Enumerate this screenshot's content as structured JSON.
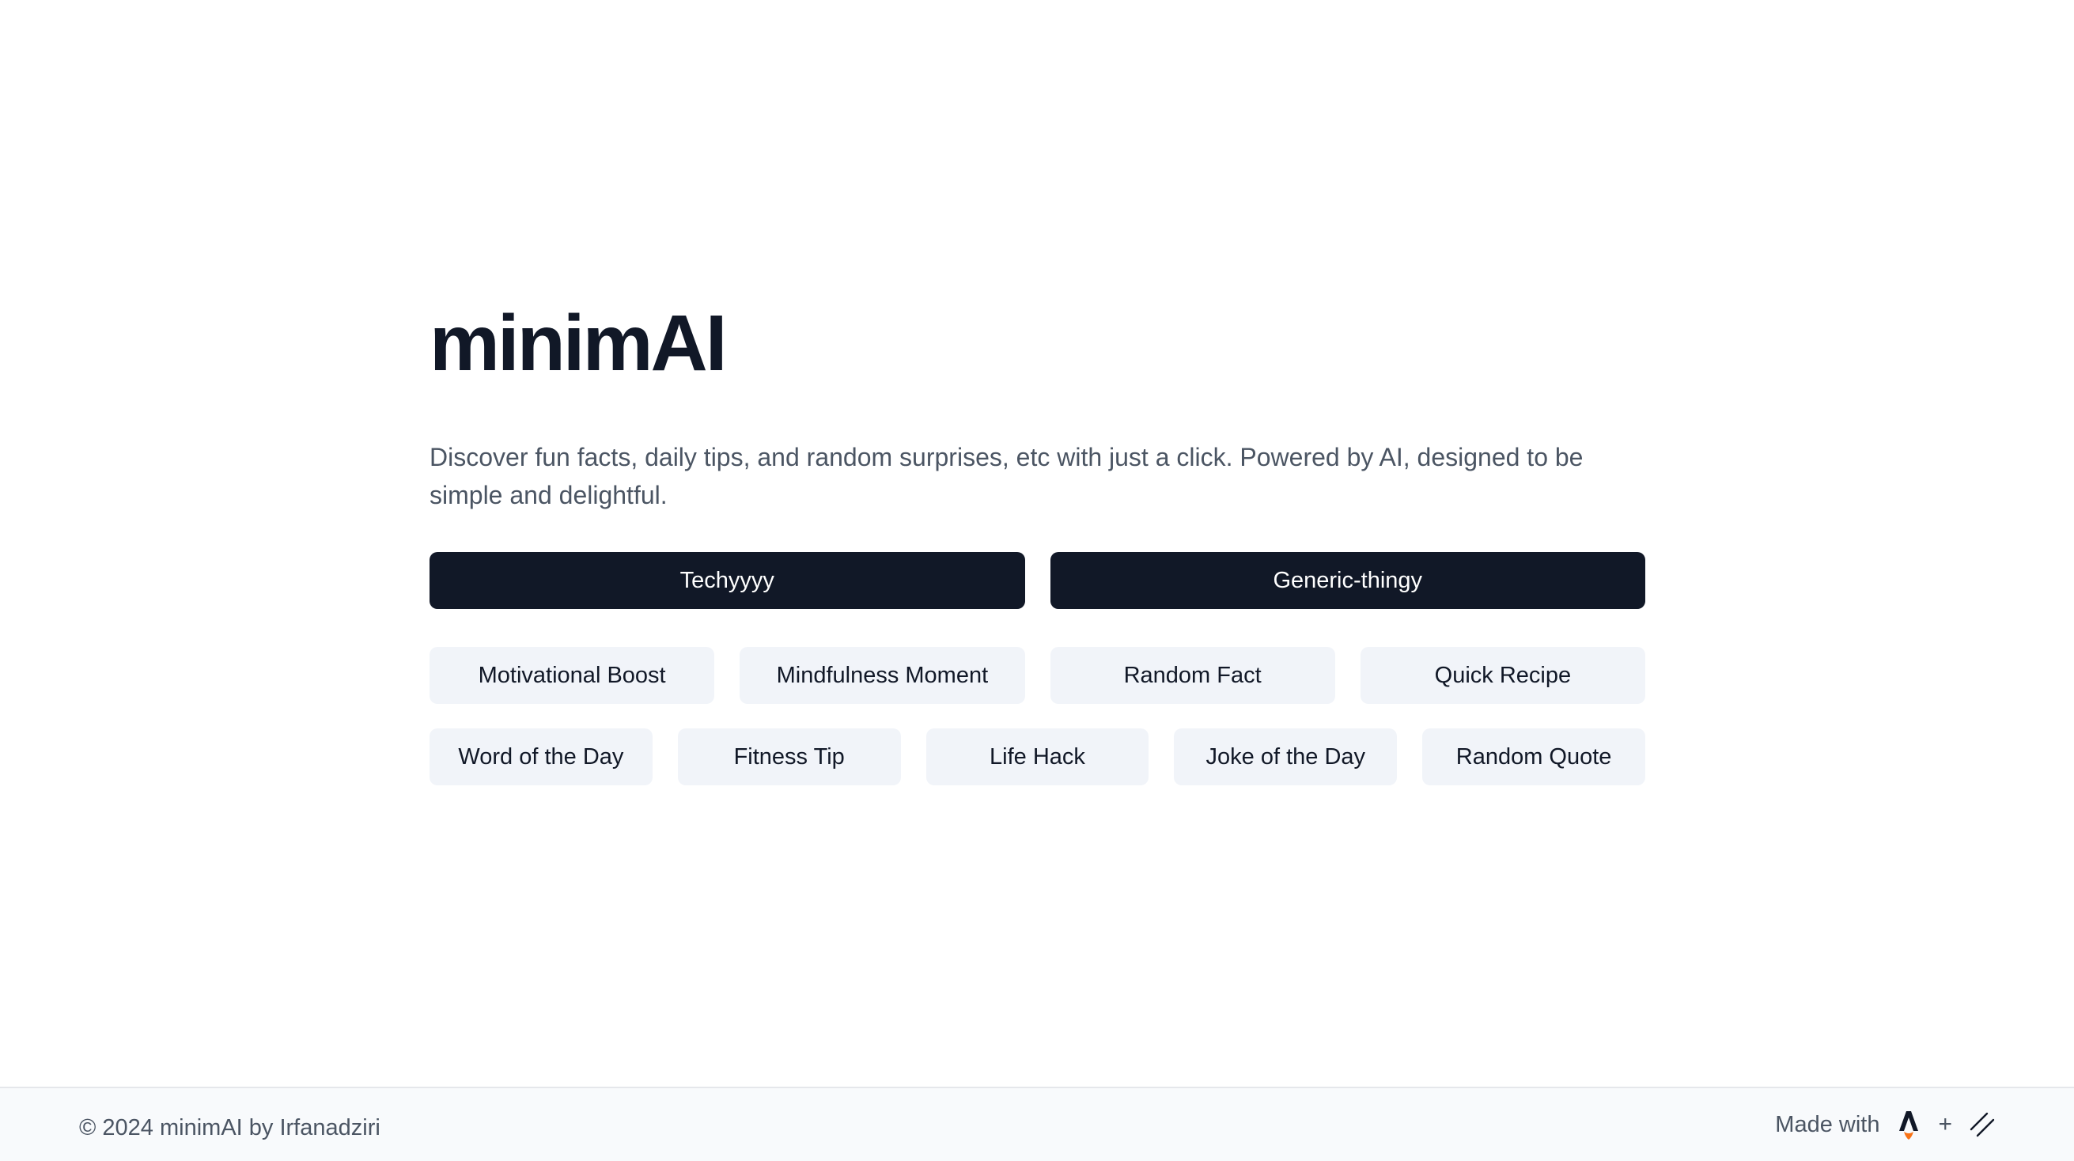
{
  "app": {
    "title": "minimAI",
    "description": "Discover fun facts, daily tips, and random surprises, etc with just a click. Powered by AI, designed to be simple and delightful."
  },
  "primary_buttons": [
    {
      "label": "Techyyyy"
    },
    {
      "label": "Generic-thingy"
    }
  ],
  "chips_row1": [
    {
      "label": "Motivational Boost"
    },
    {
      "label": "Mindfulness Moment"
    },
    {
      "label": "Random Fact"
    },
    {
      "label": "Quick Recipe"
    }
  ],
  "chips_row2": [
    {
      "label": "Word of the Day"
    },
    {
      "label": "Fitness Tip"
    },
    {
      "label": "Life Hack"
    },
    {
      "label": "Joke of the Day"
    },
    {
      "label": "Random Quote"
    }
  ],
  "footer": {
    "copyright": "© 2024 minimAI by Irfanadziri",
    "made_with": "Made with",
    "plus": "+",
    "icons": [
      "astro-icon",
      "slash-lines-icon"
    ]
  },
  "colors": {
    "primary": "#111827",
    "chip_bg": "#f1f4f9",
    "muted_text": "#4b5563",
    "footer_bg": "#f8fafc",
    "accent_flame": "#f97316"
  }
}
